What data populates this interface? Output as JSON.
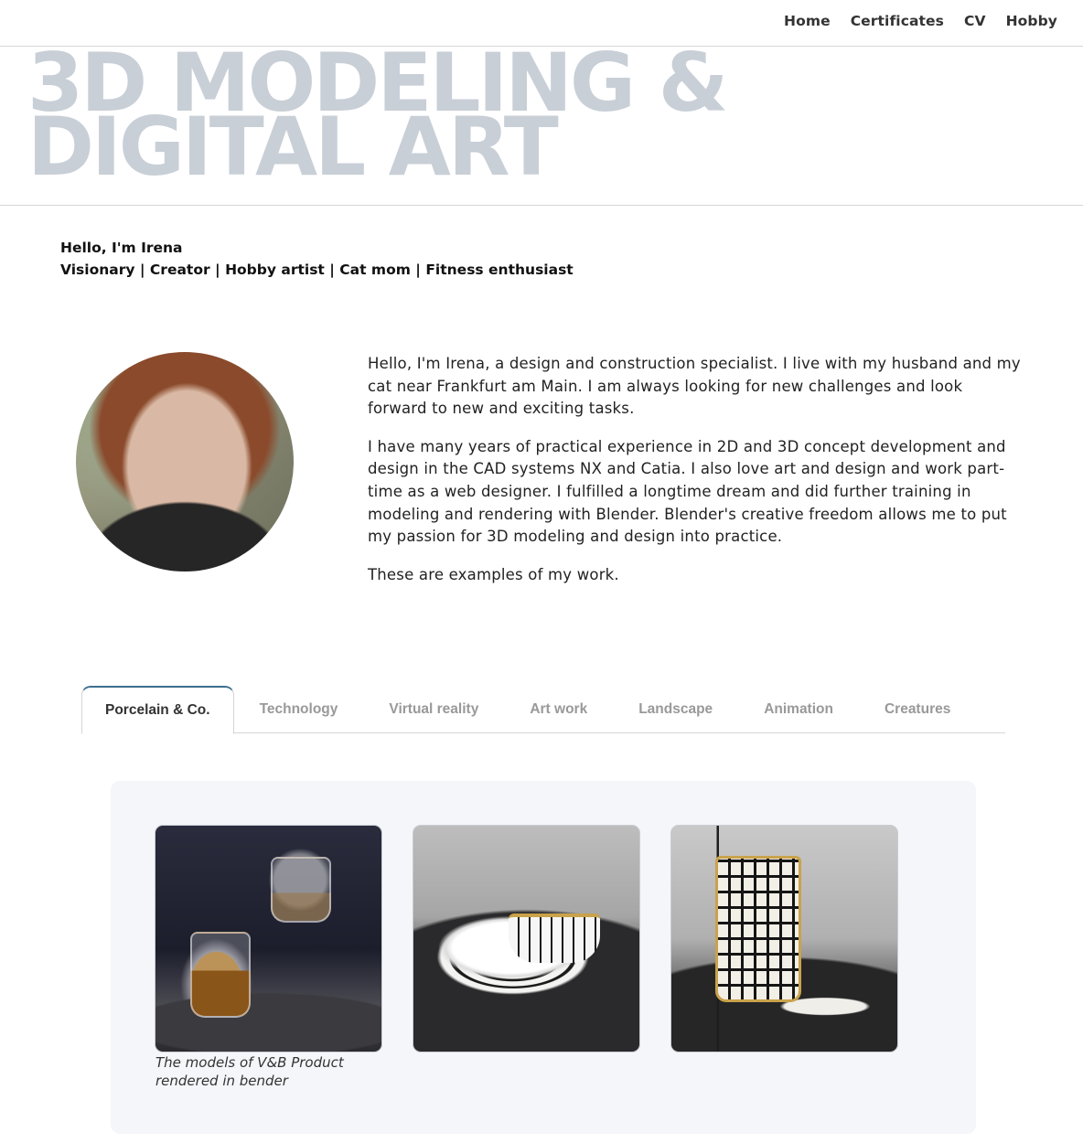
{
  "nav": {
    "items": [
      {
        "label": "Home"
      },
      {
        "label": "Certificates"
      },
      {
        "label": "CV"
      },
      {
        "label": "Hobby"
      }
    ]
  },
  "hero": {
    "title_line1": "3D MODELING &",
    "title_line2": "DIGITAL ART"
  },
  "intro": {
    "greeting": "Hello, I'm Irena",
    "tagline": "Visionary | Creator | Hobby artist | Cat mom | Fitness enthusiast"
  },
  "about": {
    "paragraphs": [
      "Hello, I'm Irena, a design and construction specialist. I live with my husband and my cat near Frankfurt am Main. I am always looking for new challenges and look forward to new and exciting tasks.",
      "I have many years of practical experience in 2D and 3D concept development and design in the CAD systems NX and Catia. I also love art and design and work part-time as a web designer. I fulfilled a longtime dream and did further training in modeling and rendering with Blender. Blender's creative freedom allows me to put my passion for 3D modeling and design into practice.",
      "These are examples of my work."
    ]
  },
  "tabs": {
    "items": [
      {
        "label": "Porcelain & Co.",
        "active": true
      },
      {
        "label": "Technology"
      },
      {
        "label": "Virtual reality"
      },
      {
        "label": "Art work"
      },
      {
        "label": "Landscape"
      },
      {
        "label": "Animation"
      },
      {
        "label": "Creatures"
      }
    ]
  },
  "gallery": {
    "caption": "The models of V&B Product rendered in bender"
  }
}
